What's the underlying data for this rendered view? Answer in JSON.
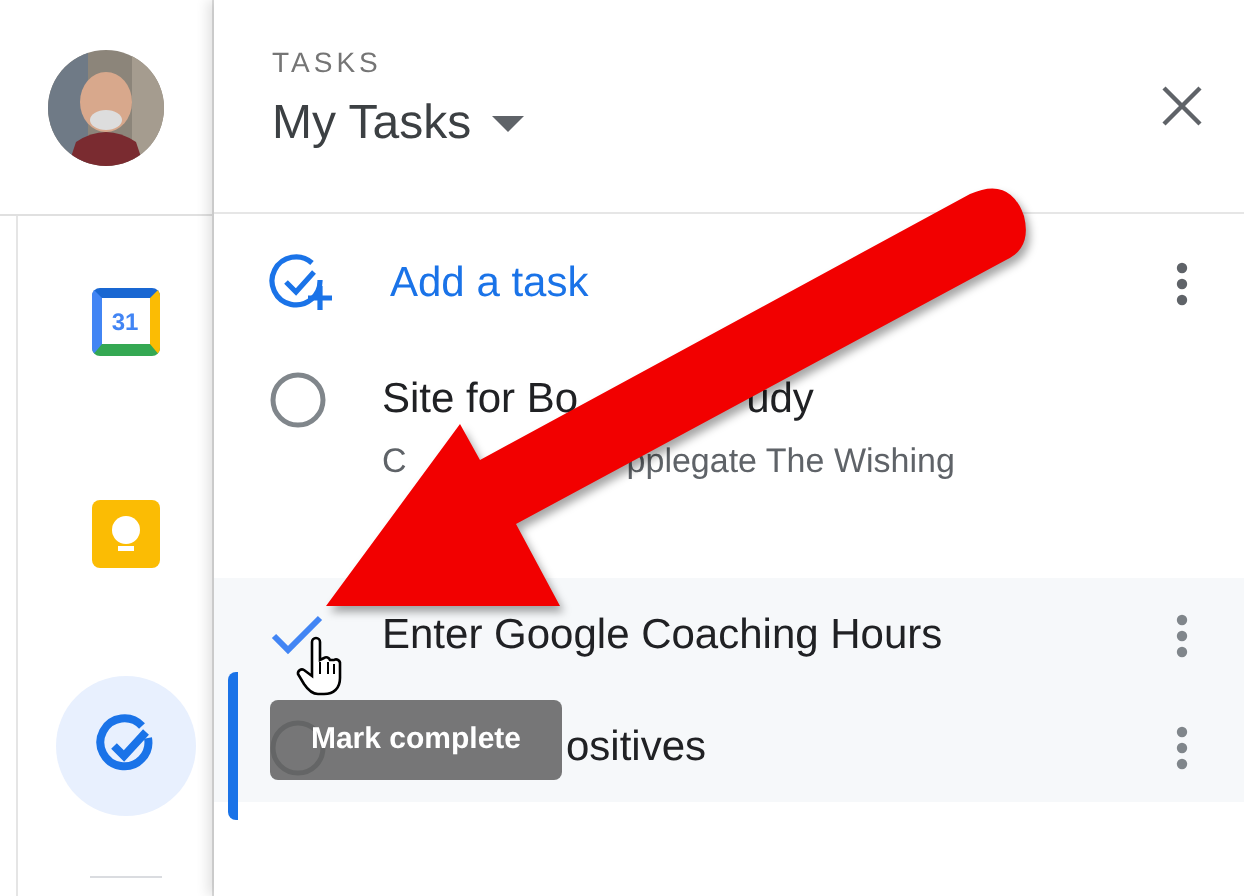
{
  "panel": {
    "label": "TASKS",
    "list_name": "My Tasks"
  },
  "add_task": {
    "label": "Add a task"
  },
  "side_apps": [
    {
      "kind": "calendar",
      "label": "31",
      "selected": false
    },
    {
      "kind": "keep",
      "selected": false
    },
    {
      "kind": "tasks",
      "selected": true
    }
  ],
  "tasks": [
    {
      "title_parts": [
        "Site for Bo",
        "udy"
      ],
      "subtitle_parts": [
        "C",
        "pplegate The Wishing"
      ],
      "hovered": false,
      "selected": false
    },
    {
      "title_parts": [
        "Enter Google Coaching Hours"
      ],
      "hovered": true,
      "selected": true
    },
    {
      "title_parts": [
        "ositives"
      ],
      "hovered": false,
      "selected": true
    }
  ],
  "tooltip": "Mark complete"
}
